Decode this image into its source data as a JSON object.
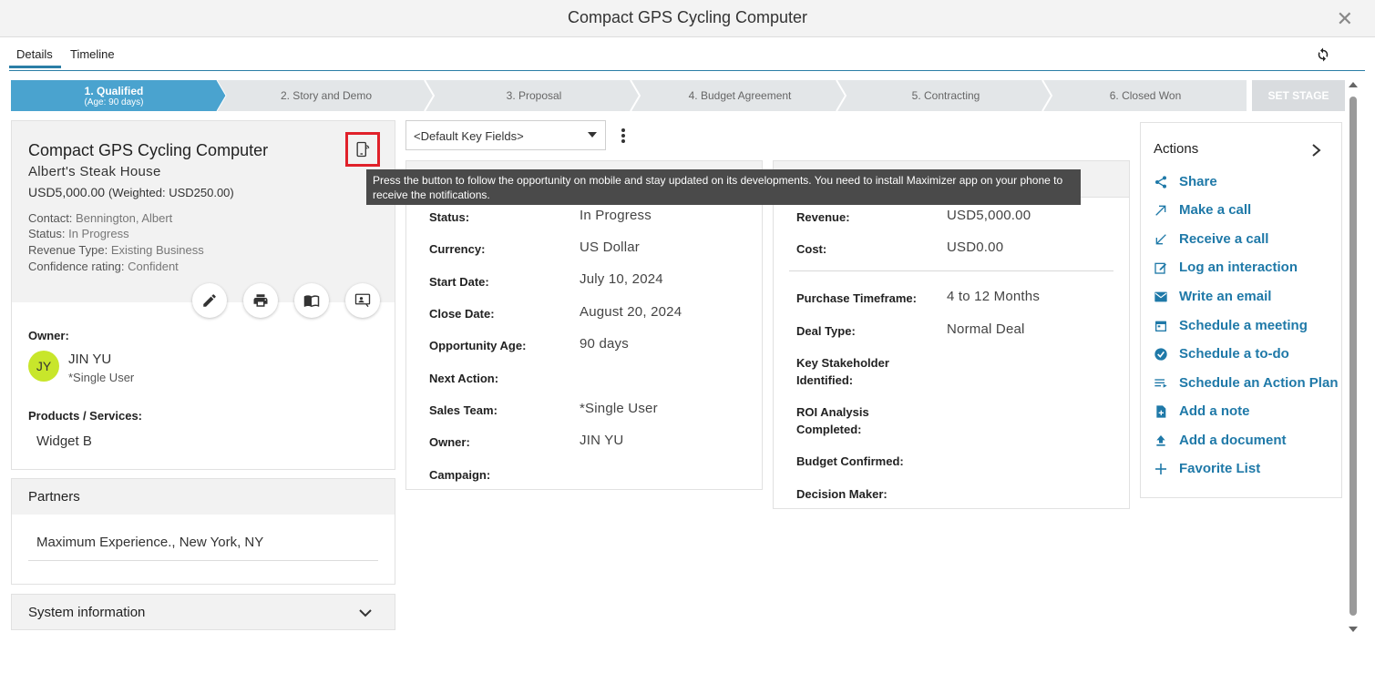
{
  "window": {
    "title": "Compact GPS Cycling Computer",
    "close_glyph": "✕"
  },
  "tabs": [
    {
      "label": "Details"
    },
    {
      "label": "Timeline"
    }
  ],
  "stages": [
    {
      "label": "1. Qualified",
      "sub": "(Age: 90 days)"
    },
    {
      "label": "2. Story and Demo"
    },
    {
      "label": "3. Proposal"
    },
    {
      "label": "4. Budget Agreement"
    },
    {
      "label": "5. Contracting"
    },
    {
      "label": "6. Closed Won"
    }
  ],
  "set_stage_label": "SET STAGE",
  "summary": {
    "title": "Compact GPS Cycling Computer",
    "company": "Albert's Steak House",
    "amount": "USD5,000.00",
    "weighted": "(Weighted: USD250.00)",
    "info": [
      {
        "label": "Contact:",
        "value": "Bennington, Albert"
      },
      {
        "label": "Status:",
        "value": "In Progress"
      },
      {
        "label": "Revenue Type:",
        "value": "Existing Business"
      },
      {
        "label": "Confidence rating:",
        "value": "Confident"
      }
    ],
    "owner_label": "Owner:",
    "owner_initials": "JY",
    "owner_name": "JIN YU",
    "owner_team": "*Single User",
    "products_label": "Products / Services:",
    "product": "Widget B"
  },
  "partners": {
    "title": "Partners",
    "item": "Maximum Experience., New York, NY"
  },
  "system_info": {
    "title": "System information"
  },
  "key_fields": {
    "selected": "<Default Key Fields>"
  },
  "tooltip": "Press the button to follow the opportunity on mobile and stay updated on its developments. You need to install Maximizer app on your phone to receive the notifications.",
  "fields_left": [
    {
      "label": "Status:",
      "value": "In Progress"
    },
    {
      "label": "Currency:",
      "value": "US Dollar"
    },
    {
      "label": "Start Date:",
      "value": "July 10, 2024"
    },
    {
      "label": "Close Date:",
      "value": "August 20, 2024"
    },
    {
      "label": "Opportunity Age:",
      "value": "90 days"
    },
    {
      "label": "Next Action:",
      "value": ""
    },
    {
      "label": "Sales Team:",
      "value": "*Single User"
    },
    {
      "label": "Owner:",
      "value": "JIN YU"
    },
    {
      "label": "Campaign:",
      "value": ""
    }
  ],
  "fields_right": [
    {
      "label": "Revenue:",
      "value": "USD5,000.00"
    },
    {
      "label": "Cost:",
      "value": "USD0.00"
    },
    {
      "label": "Purchase Timeframe:",
      "value": "4 to 12 Months"
    },
    {
      "label": "Deal Type:",
      "value": "Normal Deal"
    },
    {
      "label": "Key Stakeholder Identified:",
      "value": ""
    },
    {
      "label": "ROI Analysis Completed:",
      "value": ""
    },
    {
      "label": "Budget Confirmed:",
      "value": ""
    },
    {
      "label": "Decision Maker:",
      "value": ""
    }
  ],
  "actions": {
    "title": "Actions",
    "items": [
      {
        "label": "Share",
        "icon": "share-icon"
      },
      {
        "label": "Make a call",
        "icon": "outgoing-call-icon"
      },
      {
        "label": "Receive a call",
        "icon": "incoming-call-icon"
      },
      {
        "label": "Log an interaction",
        "icon": "edit-note-icon"
      },
      {
        "label": "Write an email",
        "icon": "email-icon"
      },
      {
        "label": "Schedule a meeting",
        "icon": "calendar-icon"
      },
      {
        "label": "Schedule a to-do",
        "icon": "check-circle-icon"
      },
      {
        "label": "Schedule an Action Plan",
        "icon": "action-plan-icon"
      },
      {
        "label": "Add a note",
        "icon": "add-note-icon"
      },
      {
        "label": "Add a document",
        "icon": "upload-icon"
      },
      {
        "label": "Favorite List",
        "icon": "plus-icon"
      }
    ]
  },
  "colors": {
    "accent": "#1f79a8",
    "stage_active": "#4aa3cf",
    "stage_inactive": "#e3e6e8",
    "highlight_box": "#e0212a",
    "avatar": "#c8e62b"
  }
}
